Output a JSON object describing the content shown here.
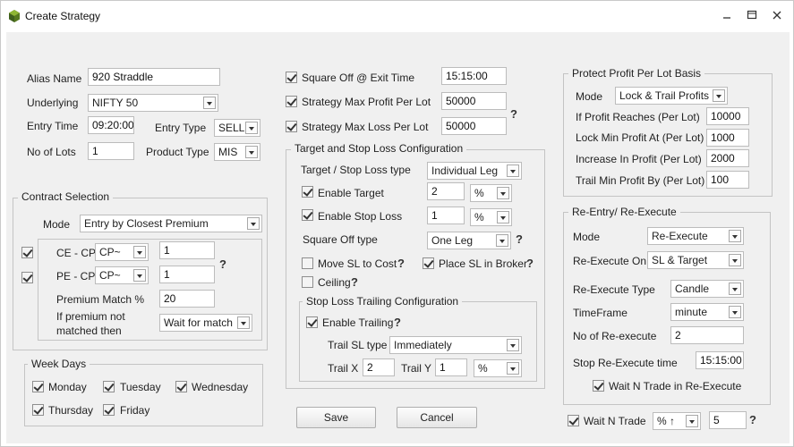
{
  "window": {
    "title": "Create Strategy"
  },
  "basic": {
    "alias_label": "Alias Name",
    "alias_value": "920 Straddle",
    "underlying_label": "Underlying",
    "underlying_value": "NIFTY 50",
    "entry_time_label": "Entry Time",
    "entry_time_value": "09:20:00",
    "entry_type_label": "Entry Type",
    "entry_type_value": "SELL",
    "lots_label": "No of Lots",
    "lots_value": "1",
    "product_type_label": "Product Type",
    "product_type_value": "MIS"
  },
  "contract": {
    "title": "Contract Selection",
    "mode_label": "Mode",
    "mode_value": "Entry by Closest Premium",
    "ce_label": "CE - CP",
    "ce_select": "CP~",
    "ce_value": "1",
    "pe_label": "PE - CP",
    "pe_select": "CP~",
    "pe_value": "1",
    "premium_label": "Premium Match %",
    "premium_value": "20",
    "not_matched_line1": "If premium not",
    "not_matched_line2": "matched then",
    "not_matched_value": "Wait for match"
  },
  "weekdays": {
    "title": "Week Days",
    "days": [
      "Monday",
      "Tuesday",
      "Wednesday",
      "Thursday",
      "Friday"
    ]
  },
  "exit": {
    "square_off_label": "Square Off @ Exit Time",
    "square_off_value": "15:15:00",
    "max_profit_label": "Strategy Max Profit Per Lot",
    "max_profit_value": "50000",
    "max_loss_label": "Strategy Max Loss Per Lot",
    "max_loss_value": "50000"
  },
  "target": {
    "title": "Target and Stop Loss Configuration",
    "type_label": "Target / Stop Loss type",
    "type_value": "Individual Leg",
    "enable_target_label": "Enable Target",
    "target_value": "2",
    "target_unit": "%",
    "enable_sl_label": "Enable Stop Loss",
    "sl_value": "1",
    "sl_unit": "%",
    "square_off_type_label": "Square Off type",
    "square_off_type_value": "One Leg",
    "move_sl_label": "Move SL to Cost",
    "place_sl_label": "Place SL in Broker",
    "ceiling_label": "Ceiling"
  },
  "trailing": {
    "title": "Stop Loss Trailing Configuration",
    "enable_label": "Enable Trailing",
    "trail_type_label": "Trail SL type",
    "trail_type_value": "Immediately",
    "trail_x_label": "Trail X",
    "trail_x_value": "2",
    "trail_y_label": "Trail Y",
    "trail_y_value": "1",
    "trail_unit": "%"
  },
  "buttons": {
    "save": "Save",
    "cancel": "Cancel"
  },
  "protect": {
    "title": "Protect Profit Per Lot Basis",
    "mode_label": "Mode",
    "mode_value": "Lock & Trail Profits",
    "reaches_label": "If Profit Reaches (Per Lot)",
    "reaches_value": "10000",
    "lock_label": "Lock Min Profit At (Per Lot)",
    "lock_value": "1000",
    "increase_label": "Increase In Profit (Per Lot)",
    "increase_value": "2000",
    "trail_label": "Trail Min Profit By (Per Lot)",
    "trail_value": "100"
  },
  "reentry": {
    "title": "Re-Entry/ Re-Execute",
    "mode_label": "Mode",
    "mode_value": "Re-Execute",
    "on_label": "Re-Execute On",
    "on_value": "SL & Target",
    "type_label": "Re-Execute Type",
    "type_value": "Candle",
    "timeframe_label": "TimeFrame",
    "timeframe_value": "minute",
    "count_label": "No of Re-execute",
    "count_value": "2",
    "stop_time_label": "Stop Re-Execute time",
    "stop_time_value": "15:15:00",
    "wait_label": "Wait N Trade in Re-Execute"
  },
  "wait_n": {
    "label": "Wait N Trade",
    "select_value": "% ↑",
    "value": "5"
  },
  "help_glyph": "?"
}
